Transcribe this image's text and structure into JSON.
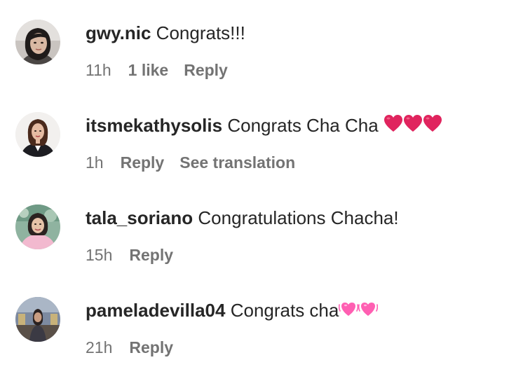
{
  "comments": [
    {
      "username": "gwy.nic",
      "text": "Congrats!!!",
      "time": "11h",
      "likes": "1 like",
      "reply": "Reply"
    },
    {
      "username": "itsmekathysolis",
      "text": "Congrats Cha Cha",
      "emoji": "red-heart x3",
      "time": "1h",
      "reply": "Reply",
      "translation": "See translation"
    },
    {
      "username": "tala_soriano",
      "text": "Congratulations Chacha!",
      "time": "15h",
      "reply": "Reply"
    },
    {
      "username": "pameladevilla04",
      "text": "Congrats cha",
      "emoji": "beating-heart x2",
      "time": "21h",
      "reply": "Reply"
    }
  ],
  "colors": {
    "text_primary": "#262626",
    "text_secondary": "#737373",
    "heart_red": "#e0245e",
    "heart_pink": "#ff5fb2"
  }
}
